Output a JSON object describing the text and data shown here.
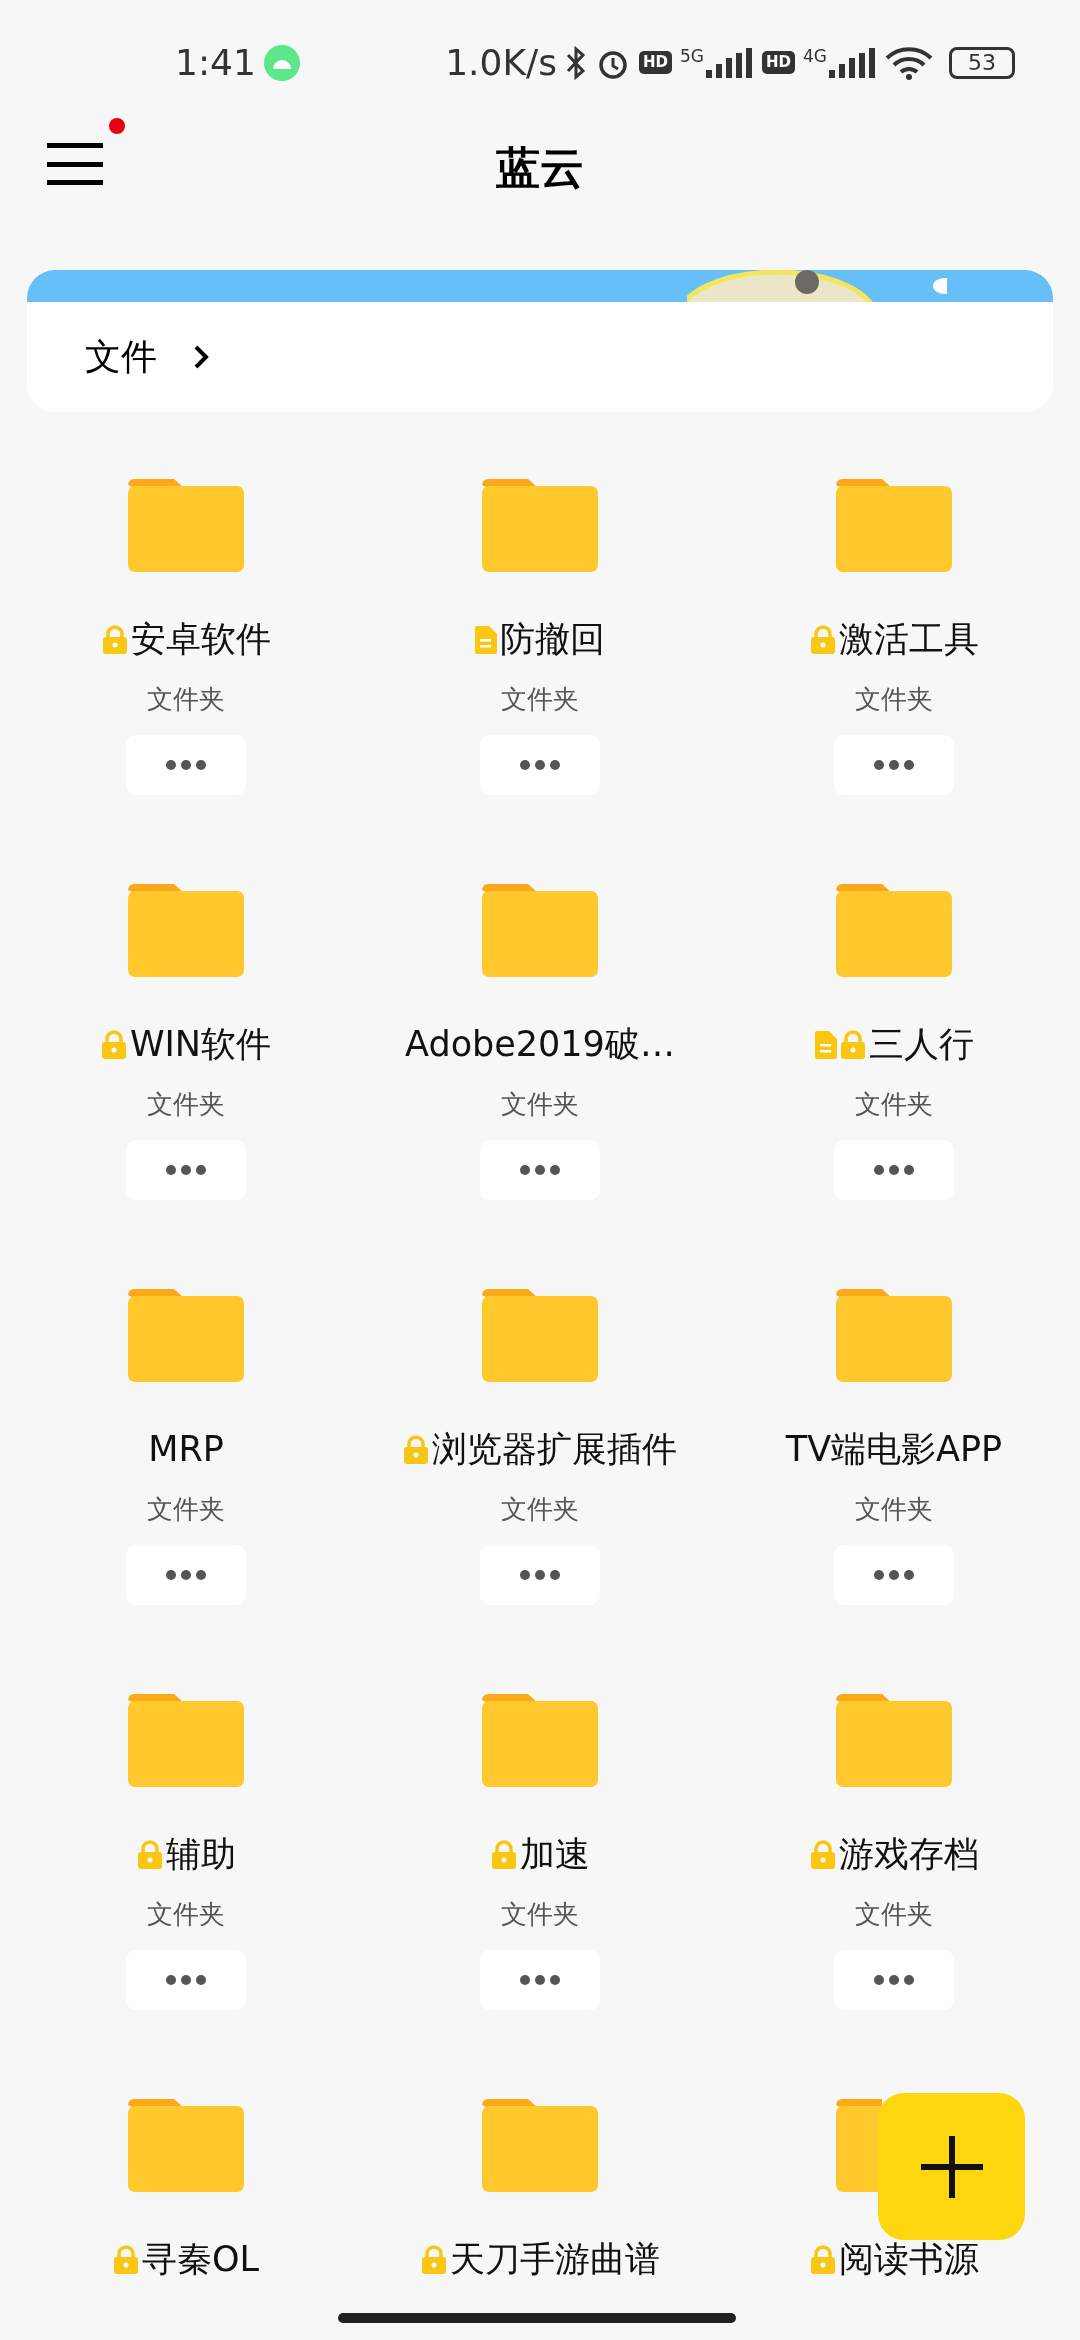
{
  "status_bar": {
    "time": "1:41",
    "speed": "1.0K/s",
    "sim1_hd": "HD",
    "sim1_network": "5G",
    "sim2_hd": "HD",
    "sim2_network": "4G",
    "battery": "53"
  },
  "app_bar": {
    "title": "蓝云",
    "menu_badge": true
  },
  "breadcrumb": {
    "label": "文件"
  },
  "folders": [
    {
      "name": "安卓软件",
      "subtitle": "文件夹",
      "locked": true,
      "note": false
    },
    {
      "name": "防撤回",
      "subtitle": "文件夹",
      "locked": false,
      "note": true
    },
    {
      "name": "激活工具",
      "subtitle": "文件夹",
      "locked": true,
      "note": false
    },
    {
      "name": "WIN软件",
      "subtitle": "文件夹",
      "locked": true,
      "note": false
    },
    {
      "name": "Adobe2019破…",
      "subtitle": "文件夹",
      "locked": false,
      "note": false
    },
    {
      "name": "三人行",
      "subtitle": "文件夹",
      "locked": true,
      "note": true
    },
    {
      "name": "MRP",
      "subtitle": "文件夹",
      "locked": false,
      "note": false
    },
    {
      "name": "浏览器扩展插件",
      "subtitle": "文件夹",
      "locked": true,
      "note": false
    },
    {
      "name": "TV端电影APP",
      "subtitle": "文件夹",
      "locked": false,
      "note": false
    },
    {
      "name": "辅助",
      "subtitle": "文件夹",
      "locked": true,
      "note": false
    },
    {
      "name": "加速",
      "subtitle": "文件夹",
      "locked": true,
      "note": false
    },
    {
      "name": "游戏存档",
      "subtitle": "文件夹",
      "locked": true,
      "note": false
    },
    {
      "name": "寻秦OL",
      "locked": true,
      "note": false
    },
    {
      "name": "天刀手游曲谱",
      "locked": true,
      "note": false
    },
    {
      "name": "阅读书源",
      "locked": true,
      "note": false
    }
  ]
}
